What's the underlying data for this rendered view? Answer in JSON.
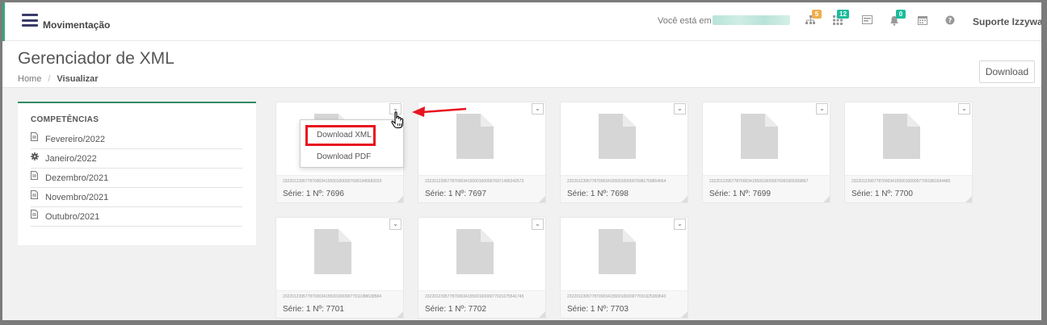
{
  "topbar": {
    "title": "Movimentação",
    "you_are_label": "Você está em :",
    "user": "Suporte Izzyway",
    "badges": [
      {
        "icon": "sitemap-icon",
        "count": "5",
        "color": "#f0ad4e"
      },
      {
        "icon": "grid-icon",
        "count": "12",
        "color": "#1abc9c"
      },
      {
        "icon": "card-icon",
        "count": "",
        "color": ""
      },
      {
        "icon": "bell-icon",
        "count": "0",
        "color": "#1abc9c"
      },
      {
        "icon": "calendar-icon",
        "count": "",
        "color": ""
      },
      {
        "icon": "help-icon",
        "count": "",
        "color": ""
      }
    ]
  },
  "page": {
    "title": "Gerenciador de XML",
    "breadcrumb": [
      "Home",
      "Visualizar"
    ],
    "download_button": "Download"
  },
  "competencias": {
    "title": "COMPETÊNCIAS",
    "items": [
      {
        "label": "Fevereiro/2022",
        "icon": "file-icon",
        "selected": false
      },
      {
        "label": "Janeiro/2022",
        "icon": "gear-icon",
        "selected": true
      },
      {
        "label": "Dezembro/2021",
        "icon": "file-icon",
        "selected": false
      },
      {
        "label": "Novembro/2021",
        "icon": "file-icon",
        "selected": false
      },
      {
        "label": "Outubro/2021",
        "icon": "file-icon",
        "selected": false
      }
    ]
  },
  "cards": [
    {
      "key": "23220123957787000341550010000076961945683033",
      "serie": "Série: 1 Nº: 7696"
    },
    {
      "key": "23220123957787000341550010000076971495342573",
      "serie": "Série: 1 Nº: 7697"
    },
    {
      "key": "23220123957787000341550010000076981759854564",
      "serie": "Série: 1 Nº: 7698"
    },
    {
      "key": "23220123957787000341550010000076991565369857",
      "serie": "Série: 1 Nº: 7699"
    },
    {
      "key": "23220123957787000341550010000077001881694485",
      "serie": "Série: 1 Nº: 7700"
    },
    {
      "key": "23220123957787000341550010000077011088638584",
      "serie": "Série: 1 Nº: 7701"
    },
    {
      "key": "23220123957787000341550010000077021675541745",
      "serie": "Série: 1 Nº: 7702"
    },
    {
      "key": "23220123957787000341550010000077031925369543",
      "serie": "Série: 1 Nº: 7703"
    }
  ],
  "dropdown": {
    "items": [
      "Download XML",
      "Download PDF"
    ],
    "highlight_color": "#e8141f"
  },
  "colors": {
    "accent": "#2f8a66",
    "nav_dark": "#3a3a6a",
    "annotation": "#e8141f"
  }
}
